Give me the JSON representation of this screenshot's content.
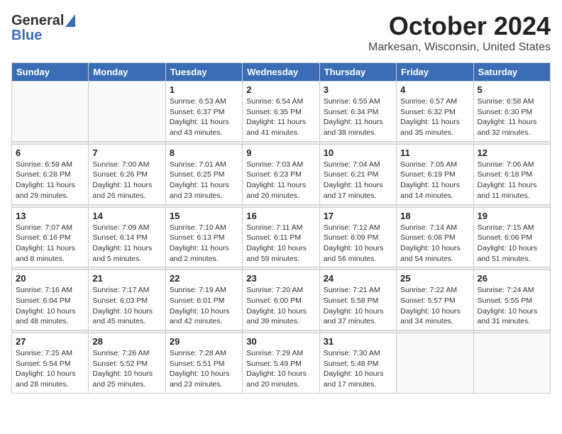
{
  "header": {
    "logo_general": "General",
    "logo_blue": "Blue",
    "month_title": "October 2024",
    "location": "Markesan, Wisconsin, United States"
  },
  "weekdays": [
    "Sunday",
    "Monday",
    "Tuesday",
    "Wednesday",
    "Thursday",
    "Friday",
    "Saturday"
  ],
  "weeks": [
    [
      {
        "day": "",
        "info": ""
      },
      {
        "day": "",
        "info": ""
      },
      {
        "day": "1",
        "sunrise": "Sunrise: 6:53 AM",
        "sunset": "Sunset: 6:37 PM",
        "daylight": "Daylight: 11 hours and 43 minutes."
      },
      {
        "day": "2",
        "sunrise": "Sunrise: 6:54 AM",
        "sunset": "Sunset: 6:35 PM",
        "daylight": "Daylight: 11 hours and 41 minutes."
      },
      {
        "day": "3",
        "sunrise": "Sunrise: 6:55 AM",
        "sunset": "Sunset: 6:34 PM",
        "daylight": "Daylight: 11 hours and 38 minutes."
      },
      {
        "day": "4",
        "sunrise": "Sunrise: 6:57 AM",
        "sunset": "Sunset: 6:32 PM",
        "daylight": "Daylight: 11 hours and 35 minutes."
      },
      {
        "day": "5",
        "sunrise": "Sunrise: 6:58 AM",
        "sunset": "Sunset: 6:30 PM",
        "daylight": "Daylight: 11 hours and 32 minutes."
      }
    ],
    [
      {
        "day": "6",
        "sunrise": "Sunrise: 6:59 AM",
        "sunset": "Sunset: 6:28 PM",
        "daylight": "Daylight: 11 hours and 29 minutes."
      },
      {
        "day": "7",
        "sunrise": "Sunrise: 7:00 AM",
        "sunset": "Sunset: 6:26 PM",
        "daylight": "Daylight: 11 hours and 26 minutes."
      },
      {
        "day": "8",
        "sunrise": "Sunrise: 7:01 AM",
        "sunset": "Sunset: 6:25 PM",
        "daylight": "Daylight: 11 hours and 23 minutes."
      },
      {
        "day": "9",
        "sunrise": "Sunrise: 7:03 AM",
        "sunset": "Sunset: 6:23 PM",
        "daylight": "Daylight: 11 hours and 20 minutes."
      },
      {
        "day": "10",
        "sunrise": "Sunrise: 7:04 AM",
        "sunset": "Sunset: 6:21 PM",
        "daylight": "Daylight: 11 hours and 17 minutes."
      },
      {
        "day": "11",
        "sunrise": "Sunrise: 7:05 AM",
        "sunset": "Sunset: 6:19 PM",
        "daylight": "Daylight: 11 hours and 14 minutes."
      },
      {
        "day": "12",
        "sunrise": "Sunrise: 7:06 AM",
        "sunset": "Sunset: 6:18 PM",
        "daylight": "Daylight: 11 hours and 11 minutes."
      }
    ],
    [
      {
        "day": "13",
        "sunrise": "Sunrise: 7:07 AM",
        "sunset": "Sunset: 6:16 PM",
        "daylight": "Daylight: 11 hours and 8 minutes."
      },
      {
        "day": "14",
        "sunrise": "Sunrise: 7:09 AM",
        "sunset": "Sunset: 6:14 PM",
        "daylight": "Daylight: 11 hours and 5 minutes."
      },
      {
        "day": "15",
        "sunrise": "Sunrise: 7:10 AM",
        "sunset": "Sunset: 6:13 PM",
        "daylight": "Daylight: 11 hours and 2 minutes."
      },
      {
        "day": "16",
        "sunrise": "Sunrise: 7:11 AM",
        "sunset": "Sunset: 6:11 PM",
        "daylight": "Daylight: 10 hours and 59 minutes."
      },
      {
        "day": "17",
        "sunrise": "Sunrise: 7:12 AM",
        "sunset": "Sunset: 6:09 PM",
        "daylight": "Daylight: 10 hours and 56 minutes."
      },
      {
        "day": "18",
        "sunrise": "Sunrise: 7:14 AM",
        "sunset": "Sunset: 6:08 PM",
        "daylight": "Daylight: 10 hours and 54 minutes."
      },
      {
        "day": "19",
        "sunrise": "Sunrise: 7:15 AM",
        "sunset": "Sunset: 6:06 PM",
        "daylight": "Daylight: 10 hours and 51 minutes."
      }
    ],
    [
      {
        "day": "20",
        "sunrise": "Sunrise: 7:16 AM",
        "sunset": "Sunset: 6:04 PM",
        "daylight": "Daylight: 10 hours and 48 minutes."
      },
      {
        "day": "21",
        "sunrise": "Sunrise: 7:17 AM",
        "sunset": "Sunset: 6:03 PM",
        "daylight": "Daylight: 10 hours and 45 minutes."
      },
      {
        "day": "22",
        "sunrise": "Sunrise: 7:19 AM",
        "sunset": "Sunset: 6:01 PM",
        "daylight": "Daylight: 10 hours and 42 minutes."
      },
      {
        "day": "23",
        "sunrise": "Sunrise: 7:20 AM",
        "sunset": "Sunset: 6:00 PM",
        "daylight": "Daylight: 10 hours and 39 minutes."
      },
      {
        "day": "24",
        "sunrise": "Sunrise: 7:21 AM",
        "sunset": "Sunset: 5:58 PM",
        "daylight": "Daylight: 10 hours and 37 minutes."
      },
      {
        "day": "25",
        "sunrise": "Sunrise: 7:22 AM",
        "sunset": "Sunset: 5:57 PM",
        "daylight": "Daylight: 10 hours and 34 minutes."
      },
      {
        "day": "26",
        "sunrise": "Sunrise: 7:24 AM",
        "sunset": "Sunset: 5:55 PM",
        "daylight": "Daylight: 10 hours and 31 minutes."
      }
    ],
    [
      {
        "day": "27",
        "sunrise": "Sunrise: 7:25 AM",
        "sunset": "Sunset: 5:54 PM",
        "daylight": "Daylight: 10 hours and 28 minutes."
      },
      {
        "day": "28",
        "sunrise": "Sunrise: 7:26 AM",
        "sunset": "Sunset: 5:52 PM",
        "daylight": "Daylight: 10 hours and 25 minutes."
      },
      {
        "day": "29",
        "sunrise": "Sunrise: 7:28 AM",
        "sunset": "Sunset: 5:51 PM",
        "daylight": "Daylight: 10 hours and 23 minutes."
      },
      {
        "day": "30",
        "sunrise": "Sunrise: 7:29 AM",
        "sunset": "Sunset: 5:49 PM",
        "daylight": "Daylight: 10 hours and 20 minutes."
      },
      {
        "day": "31",
        "sunrise": "Sunrise: 7:30 AM",
        "sunset": "Sunset: 5:48 PM",
        "daylight": "Daylight: 10 hours and 17 minutes."
      },
      {
        "day": "",
        "info": ""
      },
      {
        "day": "",
        "info": ""
      }
    ]
  ]
}
